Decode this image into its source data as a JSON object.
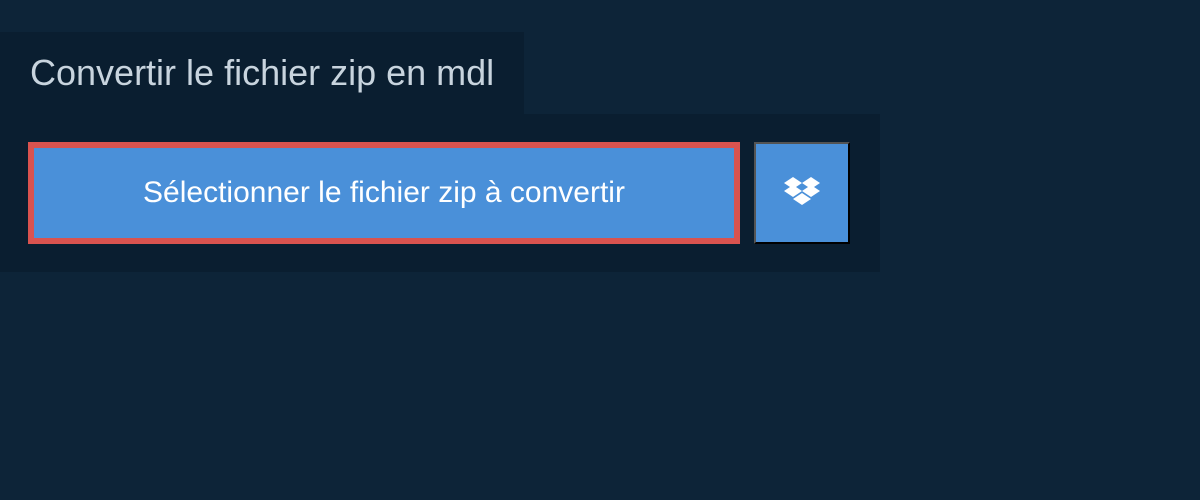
{
  "header": {
    "title": "Convertir le fichier zip en mdl"
  },
  "actions": {
    "select_file_label": "Sélectionner le fichier zip à convertir"
  },
  "colors": {
    "page_bg": "#0d2438",
    "panel_bg": "#0a1e30",
    "button_bg": "#4a90d9",
    "highlight_border": "#d9534f",
    "text_light": "#c8d4de",
    "text_white": "#ffffff"
  }
}
